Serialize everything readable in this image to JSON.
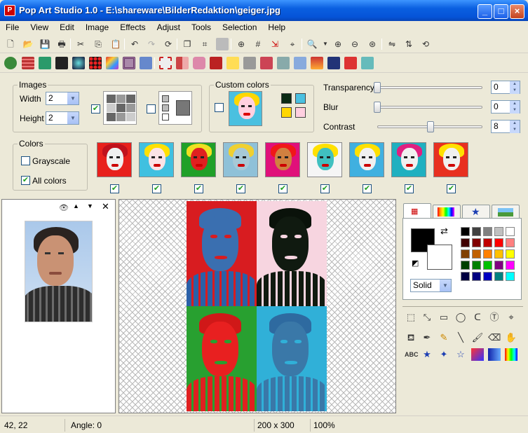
{
  "window": {
    "title": "Pop Art Studio 1.0 - E:\\shareware\\BilderRedaktion\\geiger.jpg"
  },
  "menu": [
    "File",
    "View",
    "Edit",
    "Image",
    "Effects",
    "Adjust",
    "Tools",
    "Selection",
    "Help"
  ],
  "images_group": {
    "label": "Images",
    "width_label": "Width",
    "width_value": "2",
    "height_label": "Height",
    "height_value": "2",
    "grid_checked": true,
    "arrange_checked": false
  },
  "custom_colors": {
    "label": "Custom colors",
    "checked": false,
    "swatches": [
      "#0a2a14",
      "#4ac0e0",
      "#ffd700",
      "#ffcfe0"
    ]
  },
  "adjust": {
    "transparency_label": "Transparency",
    "transparency_value": "0",
    "blur_label": "Blur",
    "blur_value": "0",
    "contrast_label": "Contrast",
    "contrast_value": "8"
  },
  "colors_group": {
    "label": "Colors",
    "grayscale_label": "Grayscale",
    "grayscale_checked": false,
    "all_colors_label": "All colors",
    "all_colors_checked": true
  },
  "thumbnails": [
    {
      "bg": "#e8201c",
      "hair": "#c0101c",
      "face": "#f0f0f0",
      "checked": true
    },
    {
      "bg": "#40c0e0",
      "hair": "#ffe000",
      "face": "#fbe3e6",
      "checked": true
    },
    {
      "bg": "#20a028",
      "hair": "#f0e020",
      "face": "#e02020",
      "checked": true
    },
    {
      "bg": "#8fc1d8",
      "hair": "#f0d030",
      "face": "#a7c9d6",
      "checked": true
    },
    {
      "bg": "#e0107a",
      "hair": "#f01818",
      "face": "#d08040",
      "checked": true
    },
    {
      "bg": "#f5f5f5",
      "hair": "#ffe000",
      "face": "#40c0c0",
      "checked": true
    },
    {
      "bg": "#40b0e0",
      "hair": "#ffe000",
      "face": "#f0f0f0",
      "checked": true
    },
    {
      "bg": "#20b0c0",
      "hair": "#e02080",
      "face": "#f0f0f0",
      "checked": true
    },
    {
      "bg": "#e83020",
      "hair": "#ffe000",
      "face": "#f0f0f0",
      "checked": true
    }
  ],
  "result_quads": [
    {
      "bg": "#d81c20",
      "face": "#3a6fb0",
      "hair": "#3a6fb0",
      "body": "#2a60a8"
    },
    {
      "bg": "#f7d5e0",
      "face": "#101a10",
      "hair": "#0a120a",
      "body": "#101a10"
    },
    {
      "bg": "#28a030",
      "face": "#e82020",
      "hair": "#d01818",
      "body": "#e02020"
    },
    {
      "bg": "#30b0d8",
      "face": "#3a78a8",
      "hair": "#2e6aa0",
      "body": "#3a78a8"
    }
  ],
  "palette": {
    "fg": "#000000",
    "bg": "#ffffff",
    "fill_style": "Solid",
    "colors": [
      "#000000",
      "#404040",
      "#808080",
      "#c0c0c0",
      "#ffffff",
      "#400000",
      "#800000",
      "#c00000",
      "#ff0000",
      "#ff8080",
      "#804000",
      "#c06000",
      "#ff8000",
      "#ffc000",
      "#ffff00",
      "#004000",
      "#008000",
      "#00c000",
      "#800080",
      "#ff00ff",
      "#000040",
      "#000080",
      "#0000c0",
      "#008080",
      "#00ffff"
    ]
  },
  "status": {
    "coords": "42, 22",
    "angle": "Angle: 0",
    "size": "200 x 300",
    "zoom": "100%"
  }
}
